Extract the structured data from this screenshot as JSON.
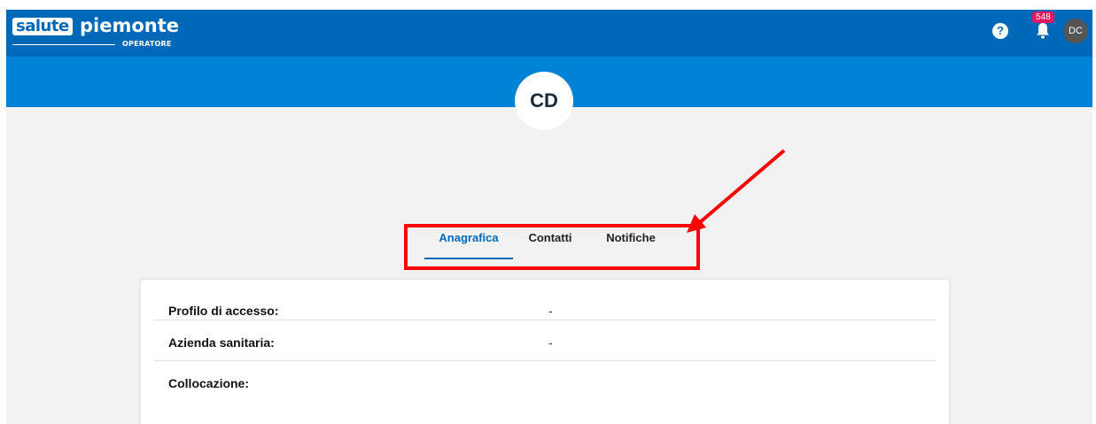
{
  "header": {
    "logo_salute": "salute",
    "logo_piemonte": "piemonte",
    "logo_subtitle": "OPERATORE",
    "help_label": "?",
    "notification_count": "548",
    "user_initials": "DC"
  },
  "profile": {
    "initials": "CD"
  },
  "tabs": [
    {
      "label": "Anagrafica",
      "active": true
    },
    {
      "label": "Contatti",
      "active": false
    },
    {
      "label": "Notifiche",
      "active": false
    }
  ],
  "details": [
    {
      "label": "Profilo di accesso:",
      "value": "-"
    },
    {
      "label": "Azienda sanitaria:",
      "value": "-"
    },
    {
      "label": "Collocazione:",
      "value": ""
    }
  ],
  "colors": {
    "topbar": "#0068b8",
    "band": "#0083d6",
    "badge": "#e5175f",
    "annotation": "#ff0000"
  },
  "icons": [
    "help-icon",
    "bell-icon",
    "arrow-annotation"
  ]
}
